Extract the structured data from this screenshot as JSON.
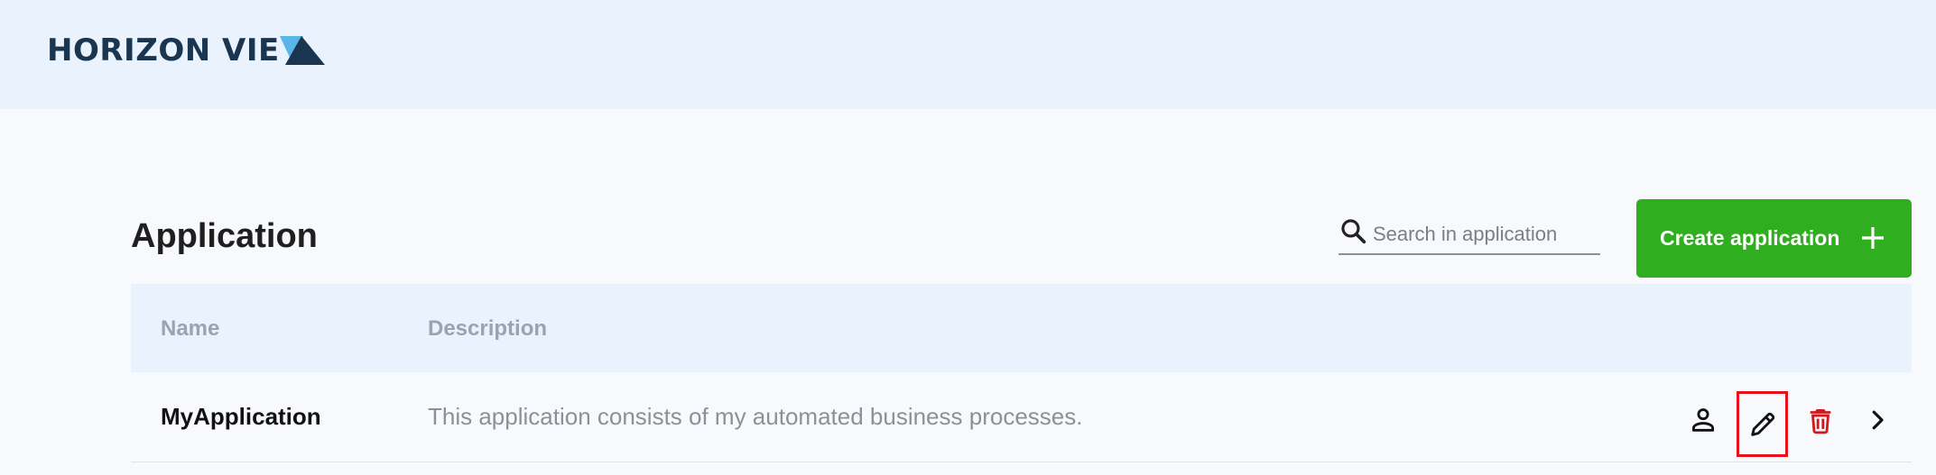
{
  "header": {
    "logo_text": "HORIZON VIE",
    "logo_colors": {
      "text": "#1a3550",
      "triangle_light": "#5bb6e8",
      "triangle_dark": "#1a3550"
    }
  },
  "page": {
    "title": "Application"
  },
  "search": {
    "placeholder": "Search in application",
    "icon": "search-icon"
  },
  "create_button": {
    "label": "Create application",
    "icon": "plus-icon",
    "color": "#2fae1f"
  },
  "table": {
    "columns": [
      "Name",
      "Description"
    ],
    "rows": [
      {
        "name": "MyApplication",
        "description": "This application consists of my automated business processes.",
        "actions": [
          "person-icon",
          "pencil-icon",
          "trash-icon",
          "chevron-right-icon"
        ]
      }
    ]
  },
  "colors": {
    "header_bg": "#eaf2fe",
    "page_bg": "#f7f9fd",
    "delete": "#d0191f",
    "highlight": "#e8111b"
  }
}
